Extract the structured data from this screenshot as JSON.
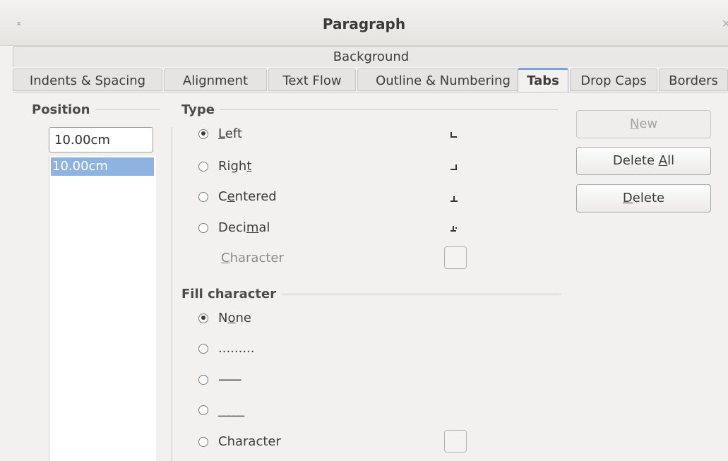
{
  "window": {
    "title": "Paragraph",
    "menu_glyph": "⌅",
    "close_glyph": "✕"
  },
  "tabs": {
    "background_label": "Background",
    "items": [
      {
        "label": "Indents & Spacing"
      },
      {
        "label": "Alignment"
      },
      {
        "label": "Text Flow"
      },
      {
        "label": "Outline & Numbering"
      },
      {
        "label": "Tabs"
      },
      {
        "label": "Drop Caps"
      },
      {
        "label": "Borders"
      }
    ],
    "active": "Tabs"
  },
  "position": {
    "heading": "Position",
    "value": "10.00cm",
    "list": [
      "10.00cm"
    ]
  },
  "type": {
    "heading": "Type",
    "options": [
      {
        "pre": "",
        "ul": "L",
        "post": "eft",
        "checked": true,
        "icon": "tab-left-icon"
      },
      {
        "pre": "Righ",
        "ul": "t",
        "post": "",
        "checked": false,
        "icon": "tab-right-icon"
      },
      {
        "pre": "C",
        "ul": "e",
        "post": "ntered",
        "checked": false,
        "icon": "tab-centered-icon"
      },
      {
        "pre": "Deci",
        "ul": "m",
        "post": "al",
        "checked": false,
        "icon": "tab-decimal-icon"
      }
    ],
    "character": {
      "pre": "",
      "ul": "C",
      "post": "haracter"
    }
  },
  "fill": {
    "heading": "Fill character",
    "none": {
      "pre": "N",
      "ul": "o",
      "post": "ne"
    },
    "dots": ".........",
    "dashes": "-------",
    "underscore": "_____",
    "character_label": "Character"
  },
  "buttons": {
    "new": {
      "pre": "",
      "ul": "N",
      "post": "ew"
    },
    "delete_all": {
      "pre": "Delete ",
      "ul": "A",
      "post": "ll"
    },
    "delete": {
      "pre": "",
      "ul": "D",
      "post": "elete"
    }
  },
  "colors": {
    "accent": "#7aa3d6",
    "selection": "#8fb3e0",
    "background": "#f2f1f0"
  }
}
